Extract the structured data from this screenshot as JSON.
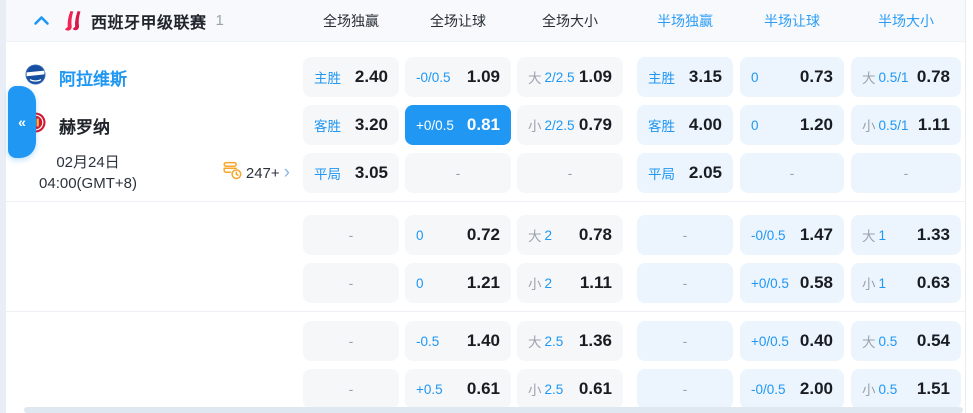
{
  "header": {
    "league": "西班牙甲级联赛",
    "count": "1",
    "columns": [
      {
        "label": "全场独赢",
        "period": "full"
      },
      {
        "label": "全场让球",
        "period": "full"
      },
      {
        "label": "全场大小",
        "period": "full"
      },
      {
        "label": "半场独赢",
        "period": "half"
      },
      {
        "label": "半场让球",
        "period": "half"
      },
      {
        "label": "半场大小",
        "period": "half"
      }
    ]
  },
  "match": {
    "home": "阿拉维斯",
    "away": "赫罗纳",
    "date": "02月24日",
    "time": "04:00(GMT+8)",
    "more_count": "247+"
  },
  "glyphs": {
    "collapse_tab": "«",
    "more_arrow": "›",
    "dash": "-"
  },
  "colors": {
    "accent": "#2097f3",
    "selected_bg": "#2097f3",
    "odds_text": "#191d22",
    "muted_text": "#9aa3ad",
    "full_cell_bg": "#f6f7f9",
    "half_cell_bg": "#ecf4fd",
    "header_bg": "#f7f9fc",
    "brand_red": "#f0234e",
    "record_icon_orange": "#f7a62a"
  },
  "sections": [
    {
      "rows": [
        {
          "slot": "home",
          "cells": [
            {
              "line": "主胜",
              "odds": "2.40"
            },
            {
              "line": "-0/0.5",
              "odds": "1.09"
            },
            {
              "muted": "大",
              "line": "2/2.5",
              "odds": "1.09"
            },
            {
              "line": "主胜",
              "odds": "3.15"
            },
            {
              "line": "0",
              "odds": "0.73"
            },
            {
              "muted": "大",
              "line": "0.5/1",
              "odds": "0.78"
            }
          ]
        },
        {
          "slot": "away",
          "cells": [
            {
              "line": "客胜",
              "odds": "3.20"
            },
            {
              "line": "+0/0.5",
              "odds": "0.81",
              "selected": true
            },
            {
              "muted": "小",
              "line": "2/2.5",
              "odds": "0.79"
            },
            {
              "line": "客胜",
              "odds": "4.00"
            },
            {
              "line": "0",
              "odds": "1.20"
            },
            {
              "muted": "小",
              "line": "0.5/1",
              "odds": "1.11"
            }
          ]
        },
        {
          "slot": "info",
          "cells": [
            {
              "line": "平局",
              "odds": "3.05"
            },
            {
              "dash": true
            },
            {
              "dash": true
            },
            {
              "line": "平局",
              "odds": "2.05"
            },
            {
              "dash": true
            },
            {
              "dash": true
            }
          ]
        }
      ]
    },
    {
      "rows": [
        {
          "cells": [
            {
              "dash": true
            },
            {
              "line": "0",
              "odds": "0.72"
            },
            {
              "muted": "大",
              "line": "2",
              "odds": "0.78"
            },
            {
              "dash": true
            },
            {
              "line": "-0/0.5",
              "odds": "1.47"
            },
            {
              "muted": "大",
              "line": "1",
              "odds": "1.33"
            }
          ]
        },
        {
          "cells": [
            {
              "dash": true
            },
            {
              "line": "0",
              "odds": "1.21"
            },
            {
              "muted": "小",
              "line": "2",
              "odds": "1.11"
            },
            {
              "dash": true
            },
            {
              "line": "+0/0.5",
              "odds": "0.58"
            },
            {
              "muted": "小",
              "line": "1",
              "odds": "0.63"
            }
          ]
        }
      ]
    },
    {
      "rows": [
        {
          "cells": [
            {
              "dash": true
            },
            {
              "line": "-0.5",
              "odds": "1.40"
            },
            {
              "muted": "大",
              "line": "2.5",
              "odds": "1.36"
            },
            {
              "dash": true
            },
            {
              "line": "+0/0.5",
              "odds": "0.40"
            },
            {
              "muted": "大",
              "line": "0.5",
              "odds": "0.54"
            }
          ]
        },
        {
          "cells": [
            {
              "dash": true
            },
            {
              "line": "+0.5",
              "odds": "0.61"
            },
            {
              "muted": "小",
              "line": "2.5",
              "odds": "0.61"
            },
            {
              "dash": true
            },
            {
              "line": "-0/0.5",
              "odds": "2.00"
            },
            {
              "muted": "小",
              "line": "0.5",
              "odds": "1.51"
            }
          ]
        }
      ]
    }
  ]
}
